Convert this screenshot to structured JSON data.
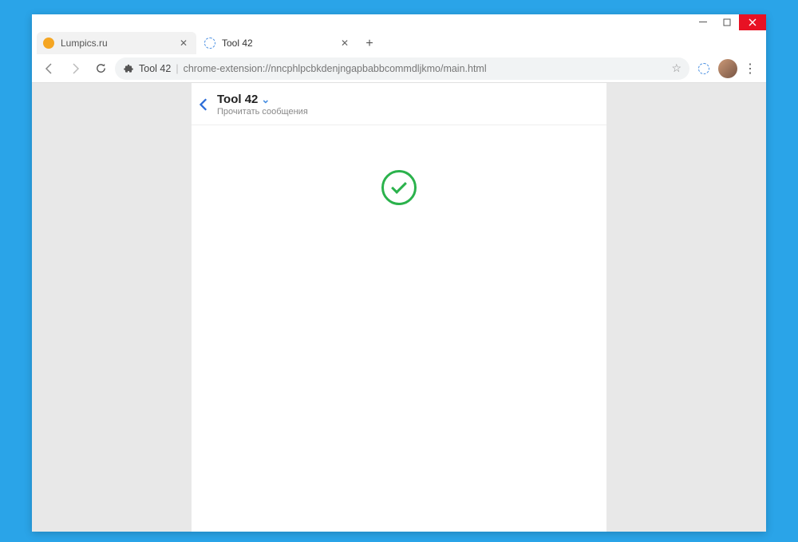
{
  "window": {
    "minimize_icon": "minimize-icon",
    "maximize_icon": "maximize-icon",
    "close_icon": "close-icon"
  },
  "tabs": [
    {
      "title": "Lumpics.ru",
      "favicon_color": "#f5a623",
      "active": false
    },
    {
      "title": "Tool 42",
      "favicon_color": "#4a90e2",
      "active": true
    }
  ],
  "toolbar": {
    "omnibox_title": "Tool 42",
    "omnibox_url": "chrome-extension://nncphlpcbkdenjngapbabbcommdljkmo/main.html"
  },
  "page": {
    "title": "Tool 42",
    "subtitle": "Прочитать сообщения"
  }
}
